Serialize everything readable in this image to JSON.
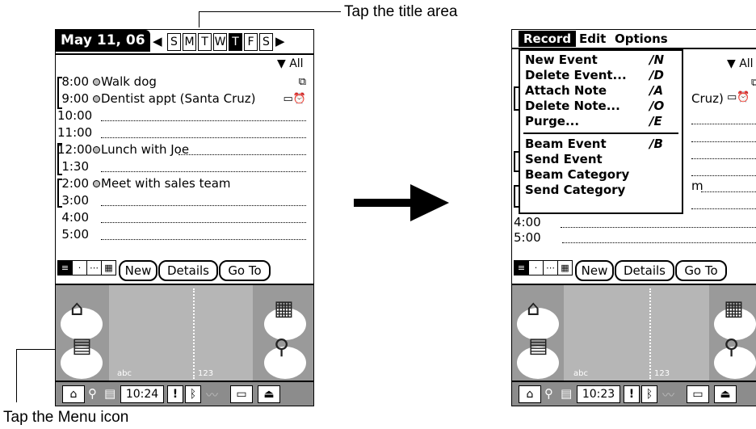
{
  "captions": {
    "title_area": "Tap the title area",
    "menu_icon": "Tap the Menu icon"
  },
  "left": {
    "date": "May 11, 06",
    "days": [
      "S",
      "M",
      "T",
      "W",
      "T",
      "F",
      "S"
    ],
    "selected_day_index": 4,
    "category": "All",
    "events": [
      {
        "time": "8:00",
        "desc": "Walk dog",
        "icon": "repeat-icon"
      },
      {
        "time": "9:00",
        "desc": "Dentist appt (Santa Cruz)",
        "icon": "note-alarm-icon"
      },
      {
        "time": "10:00",
        "desc": ""
      },
      {
        "time": "11:00",
        "desc": ""
      },
      {
        "time": "12:00",
        "desc": "Lunch with Joe"
      },
      {
        "time": "1:30",
        "desc": ""
      },
      {
        "time": "2:00",
        "desc": "Meet with sales team"
      },
      {
        "time": "3:00",
        "desc": ""
      },
      {
        "time": "4:00",
        "desc": ""
      },
      {
        "time": "5:00",
        "desc": ""
      }
    ],
    "buttons": {
      "new": "New",
      "details": "Details",
      "goto": "Go To"
    },
    "graffiti": {
      "abc": "abc",
      "num": "123"
    },
    "clock": "10:24"
  },
  "right": {
    "menubar": [
      "Record",
      "Edit",
      "Options"
    ],
    "category": "All",
    "menu_items": [
      {
        "label": "New Event",
        "shortcut": "N"
      },
      {
        "label": "Delete Event...",
        "shortcut": "D"
      },
      {
        "label": "Attach Note",
        "shortcut": "A"
      },
      {
        "label": "Delete Note...",
        "shortcut": "O"
      },
      {
        "label": "Purge...",
        "shortcut": "E"
      },
      {
        "label": "Beam Event",
        "shortcut": "B"
      },
      {
        "label": "Send Event",
        "shortcut": ""
      },
      {
        "label": "Beam Category",
        "shortcut": ""
      },
      {
        "label": "Send Category",
        "shortcut": ""
      }
    ],
    "peek_text": {
      "cruz": "Cruz)",
      "m": "m"
    },
    "visible_times": [
      "4:00",
      "5:00"
    ],
    "buttons": {
      "new": "New",
      "details": "Details",
      "goto": "Go To"
    },
    "graffiti": {
      "abc": "abc",
      "num": "123"
    },
    "clock": "10:23"
  },
  "colors": {
    "graffiti_bg": "#9a9a9a",
    "status_bg": "#8c8c8c"
  }
}
